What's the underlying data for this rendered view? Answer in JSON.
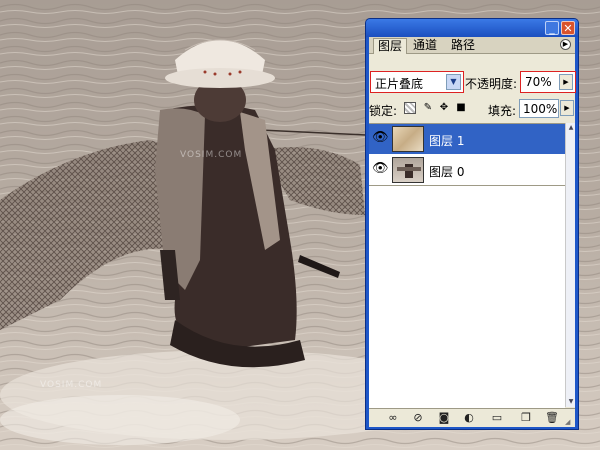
{
  "panel": {
    "title_buttons": {
      "minimize": "_",
      "close": "✕"
    },
    "tabs": [
      "图层",
      "通道",
      "路径"
    ],
    "active_tab": "图层",
    "blend_mode": "正片叠底",
    "opacity_label": "不透明度:",
    "opacity_value": "70%",
    "lock_label": "锁定:",
    "fill_label": "填充:",
    "fill_value": "100%",
    "layers": [
      {
        "name": "图层 1",
        "selected": true,
        "visible": true
      },
      {
        "name": "图层 0",
        "selected": false,
        "visible": true
      }
    ],
    "bottom_icons": [
      "link-icon",
      "layer-style-icon",
      "mask-icon",
      "adjustment-icon",
      "folder-icon",
      "new-layer-icon",
      "trash-icon"
    ],
    "accent_color": "#3163c5",
    "highlight_color": "#d22222"
  },
  "background": {
    "watermark_text": "VOSIM.COM"
  }
}
